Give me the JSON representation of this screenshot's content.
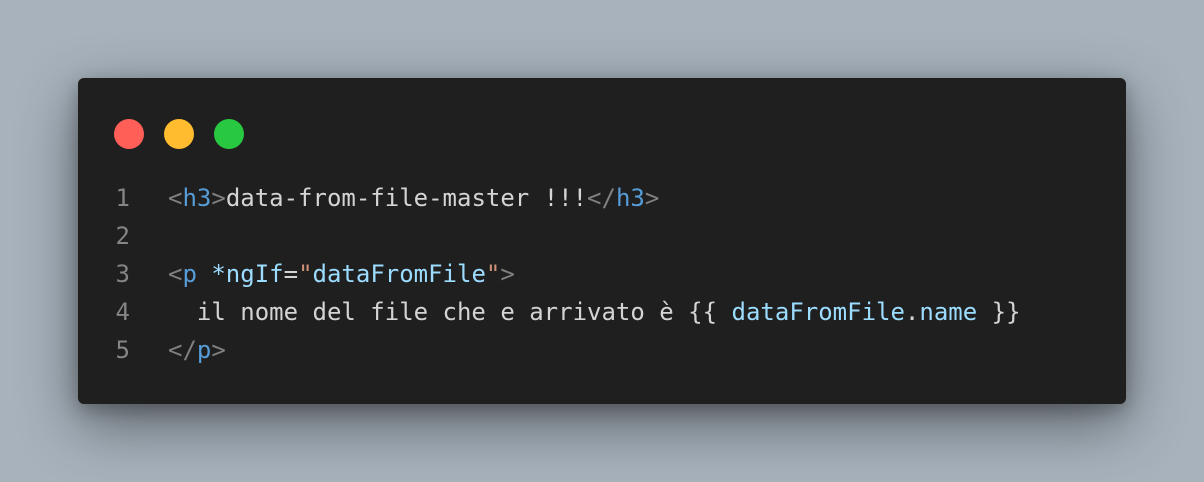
{
  "colors": {
    "close": "#ff5f57",
    "minimize": "#febc2e",
    "maximize": "#28c840"
  },
  "lines": [
    {
      "number": "1",
      "tokens": [
        {
          "text": "<",
          "kind": "brk"
        },
        {
          "text": "h3",
          "kind": "tag"
        },
        {
          "text": ">",
          "kind": "brk"
        },
        {
          "text": "data-from-file-master !!!",
          "kind": "plain"
        },
        {
          "text": "</",
          "kind": "brk"
        },
        {
          "text": "h3",
          "kind": "tag"
        },
        {
          "text": ">",
          "kind": "brk"
        }
      ]
    },
    {
      "number": "2",
      "tokens": []
    },
    {
      "number": "3",
      "tokens": [
        {
          "text": "<",
          "kind": "brk"
        },
        {
          "text": "p",
          "kind": "tag"
        },
        {
          "text": " ",
          "kind": "plain"
        },
        {
          "text": "*ngIf",
          "kind": "attr"
        },
        {
          "text": "=",
          "kind": "plain"
        },
        {
          "text": "\"",
          "kind": "str"
        },
        {
          "text": "dataFromFile",
          "kind": "var"
        },
        {
          "text": "\"",
          "kind": "str"
        },
        {
          "text": ">",
          "kind": "brk"
        }
      ]
    },
    {
      "number": "4",
      "tokens": [
        {
          "text": "  il nome del file che e arrivato è {{ ",
          "kind": "plain"
        },
        {
          "text": "dataFromFile",
          "kind": "var"
        },
        {
          "text": ".",
          "kind": "plain"
        },
        {
          "text": "name",
          "kind": "var"
        },
        {
          "text": " }}",
          "kind": "plain"
        }
      ]
    },
    {
      "number": "5",
      "tokens": [
        {
          "text": "</",
          "kind": "brk"
        },
        {
          "text": "p",
          "kind": "tag"
        },
        {
          "text": ">",
          "kind": "brk"
        }
      ]
    }
  ]
}
